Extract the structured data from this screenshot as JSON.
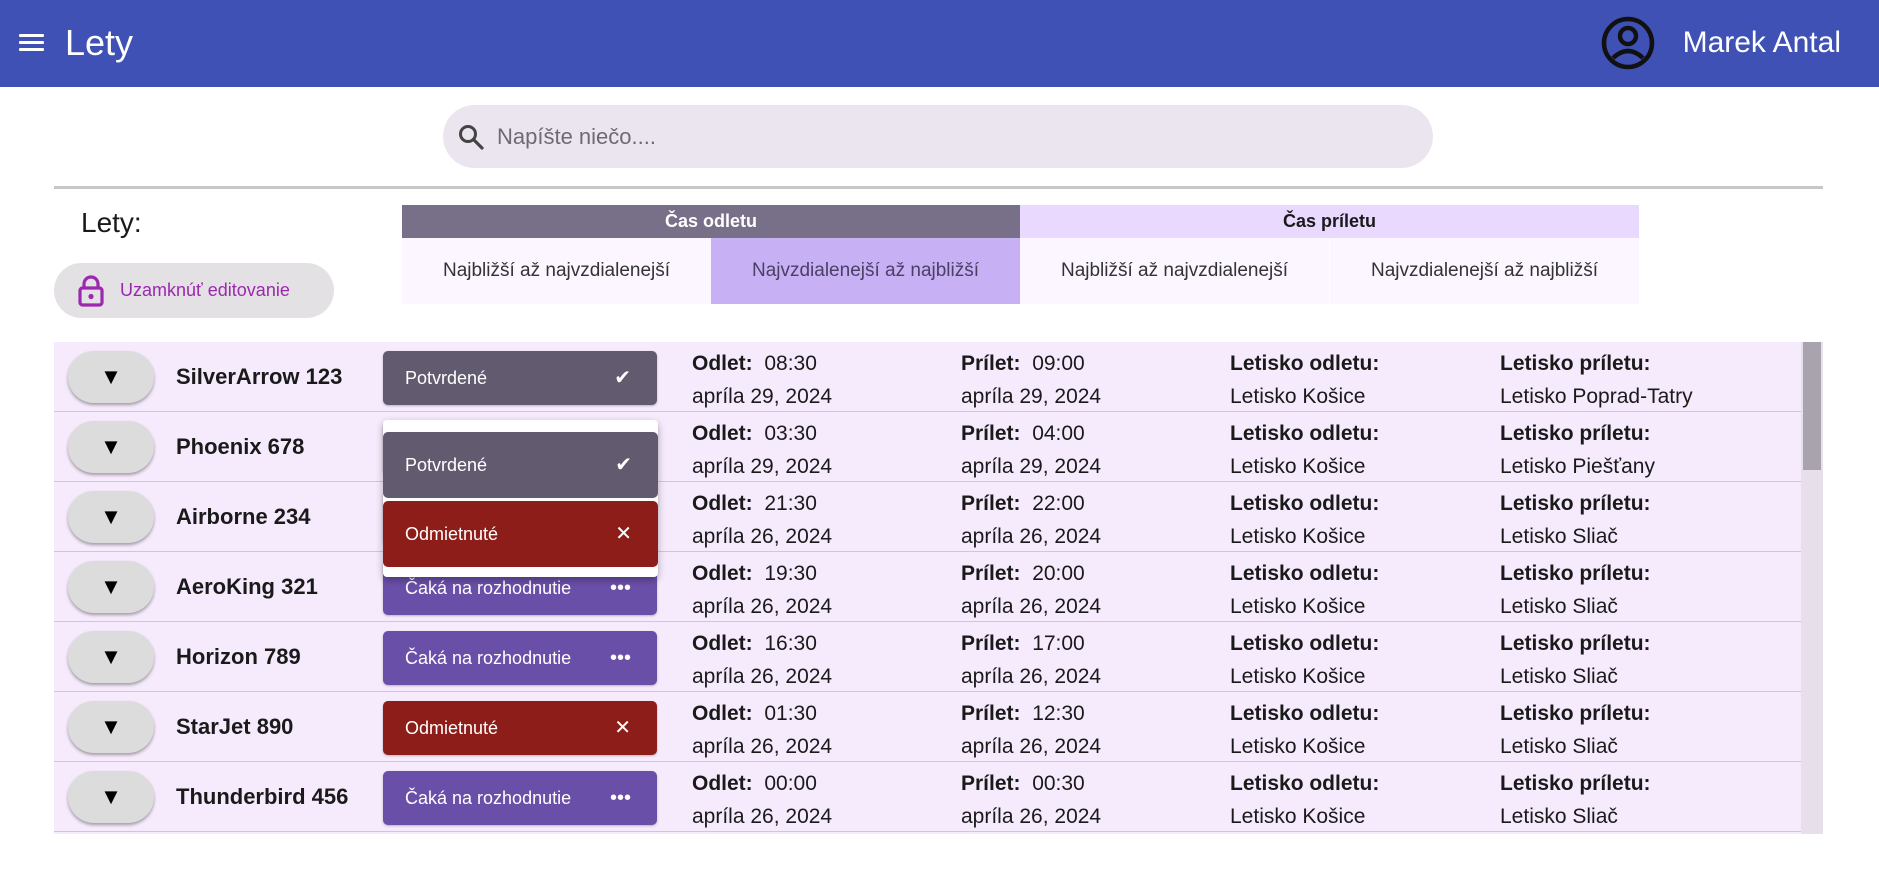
{
  "app": {
    "title": "Lety",
    "user_name": "Marek Antal"
  },
  "search": {
    "placeholder": "Napíšte niečo...."
  },
  "flights_label": "Lety:",
  "lock_button": {
    "label": "Uzamknúť editovanie"
  },
  "sort": {
    "departure_header": "Čas odletu",
    "arrival_header": "Čas príletu",
    "options": [
      {
        "label": "Najbližší až najvzdialenejší",
        "selected": false
      },
      {
        "label": "Najvzdialenejší až najbližší",
        "selected": true
      },
      {
        "label": "Najbližší až najvzdialenejší",
        "selected": false
      },
      {
        "label": "Najvzdialenejší až najbližší",
        "selected": false
      }
    ]
  },
  "labels": {
    "departure": "Odlet:",
    "arrival": "Prílet:",
    "departure_airport": "Letisko odletu:",
    "arrival_airport": "Letisko príletu:"
  },
  "flights": [
    {
      "name": "SilverArrow 123",
      "status": "Potvrdené",
      "status_type": "ok",
      "dep_time": "08:30",
      "dep_date": "apríla 29, 2024",
      "arr_time": "09:00",
      "arr_date": "apríla 29, 2024",
      "dep_airport": "Letisko Košice",
      "arr_airport": "Letisko Poprad-Tatry"
    },
    {
      "name": "Phoenix 678",
      "status": "Potvrdené",
      "status_type": "ok",
      "dep_time": "03:30",
      "dep_date": "apríla 29, 2024",
      "arr_time": "04:00",
      "arr_date": "apríla 29, 2024",
      "dep_airport": "Letisko Košice",
      "arr_airport": "Letisko Piešťany"
    },
    {
      "name": "Airborne 234",
      "status": "Odmietnuté",
      "status_type": "no",
      "dep_time": "21:30",
      "dep_date": "apríla 26, 2024",
      "arr_time": "22:00",
      "arr_date": "apríla 26, 2024",
      "dep_airport": "Letisko Košice",
      "arr_airport": "Letisko Sliač"
    },
    {
      "name": "AeroKing 321",
      "status": "Čaká na rozhodnutie",
      "status_type": "wait",
      "dep_time": "19:30",
      "dep_date": "apríla 26, 2024",
      "arr_time": "20:00",
      "arr_date": "apríla 26, 2024",
      "dep_airport": "Letisko Košice",
      "arr_airport": "Letisko Sliač"
    },
    {
      "name": "Horizon 789",
      "status": "Čaká na rozhodnutie",
      "status_type": "wait",
      "dep_time": "16:30",
      "dep_date": "apríla 26, 2024",
      "arr_time": "17:00",
      "arr_date": "apríla 26, 2024",
      "dep_airport": "Letisko Košice",
      "arr_airport": "Letisko Sliač"
    },
    {
      "name": "StarJet 890",
      "status": "Odmietnuté",
      "status_type": "no",
      "dep_time": "01:30",
      "dep_date": "apríla 26, 2024",
      "arr_time": "12:30",
      "arr_date": "apríla 26, 2024",
      "dep_airport": "Letisko Košice",
      "arr_airport": "Letisko Sliač"
    },
    {
      "name": "Thunderbird 456",
      "status": "Čaká na rozhodnutie",
      "status_type": "wait",
      "dep_time": "00:00",
      "dep_date": "apríla 26, 2024",
      "arr_time": "00:30",
      "arr_date": "apríla 26, 2024",
      "dep_airport": "Letisko Košice",
      "arr_airport": "Letisko Sliač"
    }
  ],
  "status_dropdown": {
    "options": [
      {
        "label": "Potvrdené",
        "icon": "check-icon"
      },
      {
        "label": "Odmietnuté",
        "icon": "close-icon"
      }
    ]
  },
  "icons": {
    "ok": "✔",
    "no": "✕",
    "wait": "•••",
    "expand": "▼"
  }
}
